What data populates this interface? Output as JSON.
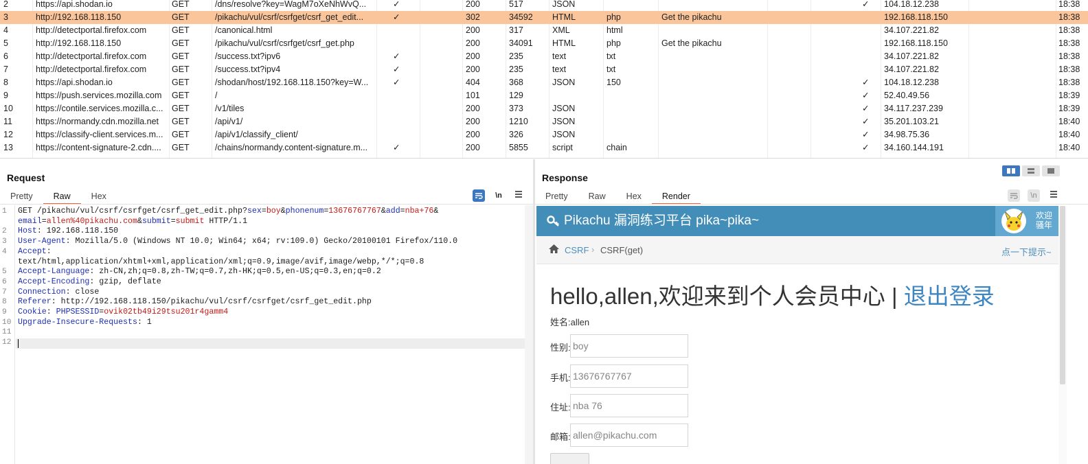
{
  "history": {
    "rows": [
      {
        "n": "2",
        "host": "https://api.shodan.io",
        "method": "GET",
        "url": "/dns/resolve?key=WagM7oXeNhWvQ...",
        "params": "✓",
        "status": "200",
        "length": "517",
        "mime": "JSON",
        "ext": "",
        "title": "",
        "tls": "✓",
        "ip": "104.18.12.238",
        "time": "18:38"
      },
      {
        "n": "3",
        "host": "http://192.168.118.150",
        "method": "GET",
        "url": "/pikachu/vul/csrf/csrfget/csrf_get_edit...",
        "params": "✓",
        "status": "302",
        "length": "34592",
        "mime": "HTML",
        "ext": "php",
        "title": "Get the pikachu",
        "tls": "",
        "ip": "192.168.118.150",
        "time": "18:38",
        "selected": true
      },
      {
        "n": "4",
        "host": "http://detectportal.firefox.com",
        "method": "GET",
        "url": "/canonical.html",
        "params": "",
        "status": "200",
        "length": "317",
        "mime": "XML",
        "ext": "html",
        "title": "",
        "tls": "",
        "ip": "34.107.221.82",
        "time": "18:38"
      },
      {
        "n": "5",
        "host": "http://192.168.118.150",
        "method": "GET",
        "url": "/pikachu/vul/csrf/csrfget/csrf_get.php",
        "params": "",
        "status": "200",
        "length": "34091",
        "mime": "HTML",
        "ext": "php",
        "title": "Get the pikachu",
        "tls": "",
        "ip": "192.168.118.150",
        "time": "18:38"
      },
      {
        "n": "6",
        "host": "http://detectportal.firefox.com",
        "method": "GET",
        "url": "/success.txt?ipv6",
        "params": "✓",
        "status": "200",
        "length": "235",
        "mime": "text",
        "ext": "txt",
        "title": "",
        "tls": "",
        "ip": "34.107.221.82",
        "time": "18:38"
      },
      {
        "n": "7",
        "host": "http://detectportal.firefox.com",
        "method": "GET",
        "url": "/success.txt?ipv4",
        "params": "✓",
        "status": "200",
        "length": "235",
        "mime": "text",
        "ext": "txt",
        "title": "",
        "tls": "",
        "ip": "34.107.221.82",
        "time": "18:38"
      },
      {
        "n": "8",
        "host": "https://api.shodan.io",
        "method": "GET",
        "url": "/shodan/host/192.168.118.150?key=W...",
        "params": "✓",
        "status": "404",
        "length": "368",
        "mime": "JSON",
        "ext": "150",
        "title": "",
        "tls": "✓",
        "ip": "104.18.12.238",
        "time": "18:38"
      },
      {
        "n": "9",
        "host": "https://push.services.mozilla.com",
        "method": "GET",
        "url": "/",
        "params": "",
        "status": "101",
        "length": "129",
        "mime": "",
        "ext": "",
        "title": "",
        "tls": "✓",
        "ip": "52.40.49.56",
        "time": "18:39"
      },
      {
        "n": "10",
        "host": "https://contile.services.mozilla.c...",
        "method": "GET",
        "url": "/v1/tiles",
        "params": "",
        "status": "200",
        "length": "373",
        "mime": "JSON",
        "ext": "",
        "title": "",
        "tls": "✓",
        "ip": "34.117.237.239",
        "time": "18:39"
      },
      {
        "n": "11",
        "host": "https://normandy.cdn.mozilla.net",
        "method": "GET",
        "url": "/api/v1/",
        "params": "",
        "status": "200",
        "length": "1210",
        "mime": "JSON",
        "ext": "",
        "title": "",
        "tls": "✓",
        "ip": "35.201.103.21",
        "time": "18:40"
      },
      {
        "n": "12",
        "host": "https://classify-client.services.m...",
        "method": "GET",
        "url": "/api/v1/classify_client/",
        "params": "",
        "status": "200",
        "length": "326",
        "mime": "JSON",
        "ext": "",
        "title": "",
        "tls": "✓",
        "ip": "34.98.75.36",
        "time": "18:40"
      },
      {
        "n": "13",
        "host": "https://content-signature-2.cdn....",
        "method": "GET",
        "url": "/chains/normandy.content-signature.m...",
        "params": "✓",
        "status": "200",
        "length": "5855",
        "mime": "script",
        "ext": "chain",
        "title": "",
        "tls": "✓",
        "ip": "34.160.144.191",
        "time": "18:40"
      }
    ]
  },
  "request": {
    "title": "Request",
    "tabs": [
      "Pretty",
      "Raw",
      "Hex"
    ],
    "active_tab": "Raw",
    "wrap_icon": "wrap-lines-icon",
    "newline_label": "\\n",
    "menu_icon": "hamburger-menu-icon",
    "line_numbers": [
      "1",
      "2",
      "3",
      "4",
      "5",
      "6",
      "7",
      "8",
      "9",
      "10",
      "11",
      "12"
    ],
    "line1": {
      "a": "GET /pikachu/vul/csrf/csrfget/csrf_get_edit.php?",
      "k1": "sex",
      "e1": "=",
      "v1": "boy",
      "amp1": "&",
      "k2": "phonenum",
      "e2": "=",
      "v2": "13676767767",
      "amp2": "&",
      "k3": "add",
      "e3": "=",
      "v3": "nba+76",
      "amp3": "&"
    },
    "line1b": {
      "k4": "email",
      "e4": "=",
      "v4": "allen%40pikachu.com",
      "amp4": "&",
      "k5": "submit",
      "e5": "=",
      "v5": "submit",
      "tail": " HTTP/1.1"
    },
    "headers": [
      {
        "name": "Host",
        "value": ": 192.168.118.150"
      },
      {
        "name": "User-Agent",
        "value": ": Mozilla/5.0 (Windows NT 10.0; Win64; x64; rv:109.0) Gecko/20100101 Firefox/110.0"
      },
      {
        "name": "Accept",
        "value": ":"
      }
    ],
    "accept_value": "text/html,application/xhtml+xml,application/xml;q=0.9,image/avif,image/webp,*/*;q=0.8",
    "headers2": [
      {
        "name": "Accept-Language",
        "value": ": zh-CN,zh;q=0.8,zh-TW;q=0.7,zh-HK;q=0.5,en-US;q=0.3,en;q=0.2"
      },
      {
        "name": "Accept-Encoding",
        "value": ": gzip, deflate"
      },
      {
        "name": "Connection",
        "value": ": close"
      },
      {
        "name": "Referer",
        "value": ": http://192.168.118.150/pikachu/vul/csrf/csrfget/csrf_get_edit.php"
      }
    ],
    "cookie": {
      "name": "Cookie",
      "sep": ": ",
      "k": "PHPSESSID",
      "e": "=",
      "v": "ovik02tb49i29tsu201r4gamm4"
    },
    "upgrade": {
      "name": "Upgrade-Insecure-Requests",
      "value": ": 1"
    }
  },
  "response": {
    "title": "Response",
    "tabs": [
      "Pretty",
      "Raw",
      "Hex",
      "Render"
    ],
    "active_tab": "Render",
    "newline_label": "\\n",
    "render": {
      "brand": "Pikachu 漏洞练习平台 pika~pika~",
      "welcome": "欢迎\n骚年",
      "crumb_home_icon": "home-icon",
      "crumb1": "CSRF",
      "crumb_sep": "›",
      "crumb2": "CSRF(get)",
      "tip": "点一下提示~",
      "hello": "hello,allen,欢迎来到个人会员中心 | ",
      "logout": "退出登录",
      "name_line": "姓名:allen",
      "fields": [
        {
          "label": "性别:",
          "value": "boy"
        },
        {
          "label": "手机:",
          "value": "13676767767"
        },
        {
          "label": "住址:",
          "value": "nba 76"
        },
        {
          "label": "邮箱:",
          "value": "allen@pikachu.com"
        }
      ]
    }
  },
  "colors": {
    "selected_row": "#fbc59b",
    "accent_tab": "#e8693c",
    "header_blue": "#438eb9",
    "link_blue": "#3e86c2"
  }
}
